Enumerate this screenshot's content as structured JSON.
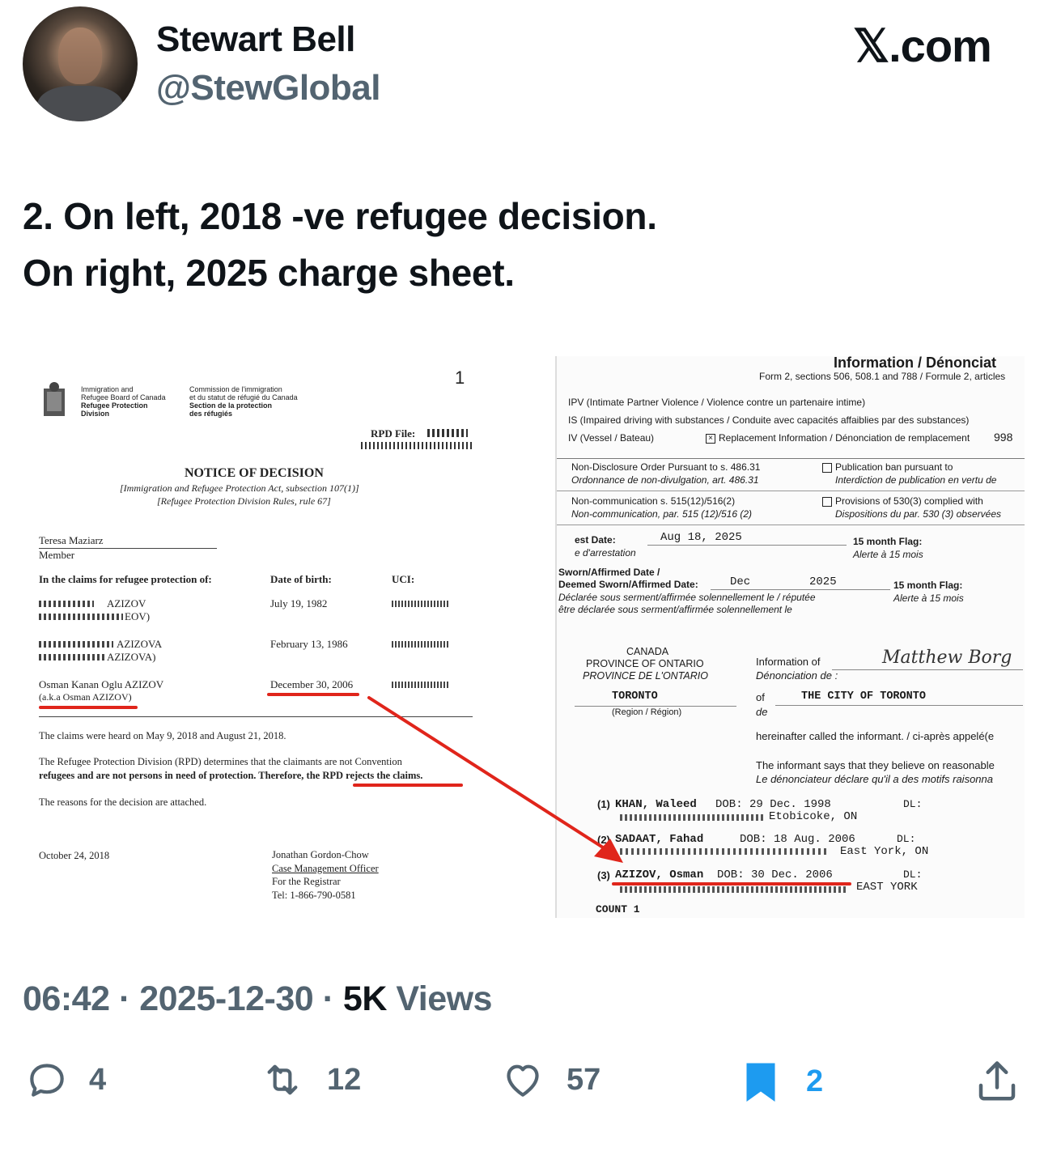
{
  "author": {
    "name": "Stewart Bell",
    "handle": "@StewGlobal"
  },
  "brand": "𝕏.com",
  "tweet": {
    "line1": "2. On left, 2018 -ve refugee decision.",
    "line2": "On right, 2025 charge sheet."
  },
  "left_doc": {
    "page_num": "1",
    "org_en": [
      "Immigration and",
      "Refugee Board of Canada",
      "Refugee Protection",
      "Division"
    ],
    "org_fr": [
      "Commission de l'immigration",
      "et du statut de réfugié du Canada",
      "Section de la protection",
      "des réfugiés"
    ],
    "file_label": "RPD File:",
    "title": "NOTICE OF DECISION",
    "subtitle1": "[Immigration and Refugee Protection Act, subsection 107(1)]",
    "subtitle2": "[Refugee Protection Division Rules, rule 67]",
    "member_name": "Teresa Maziarz",
    "member_label": "Member",
    "claims_header": "In the claims for refugee protection of:",
    "dob_header": "Date of birth:",
    "uci_header": "UCI:",
    "claimants": [
      {
        "name": "AZIZOV",
        "name2": "EOV)",
        "dob": "July 19, 1982"
      },
      {
        "name": "AZIZOVA",
        "name2": "AZIZOVA)",
        "dob": "February 13, 1986"
      },
      {
        "name": "Osman Kanan Oglu AZIZOV",
        "name2": "(a.k.a Osman AZIZOV)",
        "dob": "December 30, 2006"
      }
    ],
    "heard": "The claims were heard on May 9, 2018 and August 21, 2018.",
    "determines1": "The Refugee Protection Division (RPD) determines that the claimants are not Convention",
    "determines2": "refugees and are not persons in need of protection. Therefore, the RPD rejects the claims.",
    "reasons": "The reasons for the decision are attached.",
    "date": "October 24, 2018",
    "officer": [
      "Jonathan Gordon-Chow",
      "Case Management Officer",
      "For the Registrar",
      "Tel: 1-866-790-0581"
    ]
  },
  "right_doc": {
    "title": "Information / Dénonciat",
    "form": "Form 2, sections 506, 508.1 and 788 / Formule 2, articles",
    "ipv": "IPV (Intimate Partner Violence / Violence contre un partenaire intime)",
    "ids": "IS (Impaired driving with substances / Conduite avec capacités affaiblies par des substances)",
    "iv": "IV (Vessel / Bateau)",
    "replacement": "Replacement Information / Dénonciation de remplacement",
    "replacement_num": "998",
    "ndo1": "Non-Disclosure Order Pursuant to s. 486.31",
    "ndo2": "Ordonnance de non-divulgation, art. 486.31",
    "pub1": "Publication ban pursuant to",
    "pub2": "Interdiction de publication en vertu de",
    "nc1": "Non-communication s. 515(12)/516(2)",
    "nc2": "Non-communication, par. 515 (12)/516 (2)",
    "prov1": "Provisions of 530(3) complied with",
    "prov2": "Dispositions du par. 530 (3) observées",
    "arrest_label": "est Date:",
    "arrest_label2": "e d'arrestation",
    "arrest_date": "Aug 18, 2025",
    "flag_label": "15 month Flag:",
    "flag_label2": "Alerte à 15 mois",
    "sworn1": "Sworn/Affirmed Date /",
    "sworn2": "Deemed Sworn/Affirmed Date:",
    "sworn_month": "Dec",
    "sworn_year": "2025",
    "sworn_fr1": "Déclarée sous serment/affirmée solennellement le / réputée",
    "sworn_fr2": "être déclarée sous serment/affirmée solennellement le",
    "canada": "CANADA",
    "province": "PROVINCE OF ONTARIO",
    "province_fr": "PROVINCE DE L'ONTARIO",
    "info_of": "Information of",
    "info_of_fr": "Dénonciation de :",
    "informant": "Matthew Borg",
    "toronto": "TORONTO",
    "region": "(Region / Région)",
    "of": "of",
    "de": "de",
    "city": "THE CITY OF TORONTO",
    "hereinafter": "hereinafter called the informant. / ci-après appelé(e",
    "informant_says": "The informant says that they believe on reasonable",
    "informant_says_fr": "Le dénonciateur déclare qu'il a des motifs raisonna",
    "accused": [
      {
        "num": "(1)",
        "name": "KHAN, Waleed",
        "dob": "DOB: 29 Dec. 1998",
        "dl": "DL:",
        "place": "Etobicoke, ON"
      },
      {
        "num": "(2)",
        "name": "SADAAT, Fahad",
        "dob": "DOB: 18 Aug. 2006",
        "dl": "DL:",
        "place": "East York, ON"
      },
      {
        "num": "(3)",
        "name": "AZIZOV, Osman",
        "dob": "DOB: 30 Dec. 2006",
        "dl": "DL:",
        "place": "EAST YORK"
      }
    ],
    "count": "COUNT 1"
  },
  "footer": {
    "time": "06:42",
    "date": "2025-12-30",
    "views_count": "5K",
    "views_label": "Views",
    "replies": "4",
    "reposts": "12",
    "likes": "57",
    "bookmarks": "2"
  },
  "colors": {
    "bookmark_active": "#1d9bf0",
    "secondary": "#536471",
    "annotation_red": "#e0251b"
  }
}
